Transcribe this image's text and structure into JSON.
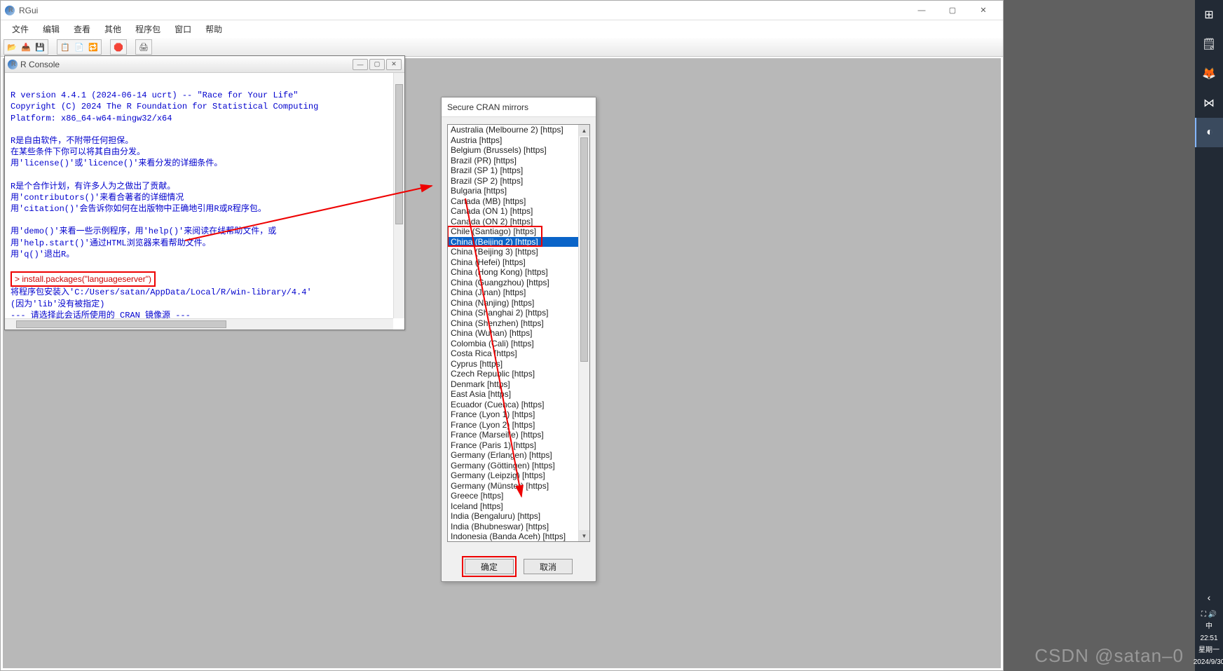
{
  "rgui": {
    "title": "RGui",
    "menus": [
      "文件",
      "编辑",
      "查看",
      "其他",
      "程序包",
      "窗口",
      "帮助"
    ],
    "win_controls": {
      "minimize": "—",
      "maximize": "▢",
      "close": "✕"
    }
  },
  "console": {
    "title": "R Console",
    "lines": [
      "",
      "R version 4.4.1 (2024-06-14 ucrt) -- \"Race for Your Life\"",
      "Copyright (C) 2024 The R Foundation for Statistical Computing",
      "Platform: x86_64-w64-mingw32/x64",
      "",
      "R是自由软件，不附带任何担保。",
      "在某些条件下你可以将其自由分发。",
      "用'license()'或'licence()'来看分发的详细条件。",
      "",
      "R是个合作计划，有许多人为之做出了贡献。",
      "用'contributors()'来看合著者的详细情况",
      "用'citation()'会告诉你如何在出版物中正确地引用R或R程序包。",
      "",
      "用'demo()'来看一些示例程序，用'help()'来阅读在线帮助文件，或",
      "用'help.start()'通过HTML浏览器来看帮助文件。",
      "用'q()'退出R。",
      ""
    ],
    "prompt_line": "> install.packages(\"languageserver\")",
    "after_prompt": [
      "将程序包安装入'C:/Users/satan/AppData/Local/R/win-library/4.4'",
      "(因为'lib'没有被指定)",
      "--- 请选择此会话所使用的 CRAN 镜像源 ---"
    ]
  },
  "dialog": {
    "title": "Secure CRAN mirrors",
    "selected_index": 11,
    "ok_label": "确定",
    "cancel_label": "取消",
    "items": [
      "Australia (Melbourne 2) [https]",
      "Austria [https]",
      "Belgium (Brussels) [https]",
      "Brazil (PR) [https]",
      "Brazil (SP 1) [https]",
      "Brazil (SP 2) [https]",
      "Bulgaria [https]",
      "Canada (MB) [https]",
      "Canada (ON 1) [https]",
      "Canada (ON 2) [https]",
      "Chile (Santiago) [https]",
      "China (Beijing 2) [https]",
      "China (Beijing 3) [https]",
      "China (Hefei) [https]",
      "China (Hong Kong) [https]",
      "China (Guangzhou) [https]",
      "China (Jinan) [https]",
      "China (Nanjing) [https]",
      "China (Shanghai 2) [https]",
      "China (Shenzhen) [https]",
      "China (Wuhan) [https]",
      "Colombia (Cali) [https]",
      "Costa Rica [https]",
      "Cyprus [https]",
      "Czech Republic [https]",
      "Denmark [https]",
      "East Asia [https]",
      "Ecuador (Cuenca) [https]",
      "France (Lyon 1) [https]",
      "France (Lyon 2) [https]",
      "France (Marseille) [https]",
      "France (Paris 1) [https]",
      "Germany (Erlangen) [https]",
      "Germany (Göttingen) [https]",
      "Germany (Leipzig) [https]",
      "Germany (Münster) [https]",
      "Greece [https]",
      "Iceland [https]",
      "India (Bengaluru) [https]",
      "India (Bhubneswar) [https]",
      "Indonesia (Banda Aceh) [https]"
    ]
  },
  "taskbar": {
    "icons": [
      {
        "name": "start-icon",
        "glyph": "⊞"
      },
      {
        "name": "sticky-notes-icon",
        "glyph": "🗒"
      },
      {
        "name": "firefox-icon",
        "glyph": "🦊"
      },
      {
        "name": "vscode-icon",
        "glyph": "⋈"
      },
      {
        "name": "rstudio-icon",
        "glyph": "◐"
      }
    ],
    "chevron": "‹",
    "tray": "⛶ 🔊",
    "ime": "中",
    "time": "22:51",
    "day": "星期一",
    "date": "2024/9/30"
  },
  "watermark": "CSDN @satan–0"
}
